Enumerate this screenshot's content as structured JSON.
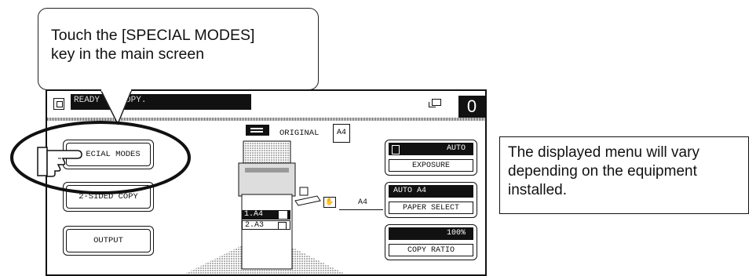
{
  "callout": {
    "text": "Touch the [SPECIAL MODES]\nkey in the main screen"
  },
  "note": {
    "text": "The displayed menu will vary depending on the equipment installed."
  },
  "status": {
    "text": "READY    COPY.",
    "copy_count": "0"
  },
  "buttons": {
    "special_modes": "ECIAL MODES",
    "two_sided_copy": "2-SIDED COPY",
    "output": "OUTPUT"
  },
  "original": {
    "label": "ORIGINAL",
    "size": "A4"
  },
  "trays": [
    {
      "label": "1.A4",
      "selected": true
    },
    {
      "label": "2.A3",
      "selected": false
    }
  ],
  "bypass": {
    "size": "A4"
  },
  "exposure": {
    "value": "AUTO",
    "label": "EXPOSURE"
  },
  "paper_select": {
    "value": "AUTO   A4",
    "label": "PAPER SELECT"
  },
  "copy_ratio": {
    "value": "100%",
    "label": "COPY RATIO"
  },
  "colors": {
    "dark": "#111111",
    "line": "#222222"
  }
}
